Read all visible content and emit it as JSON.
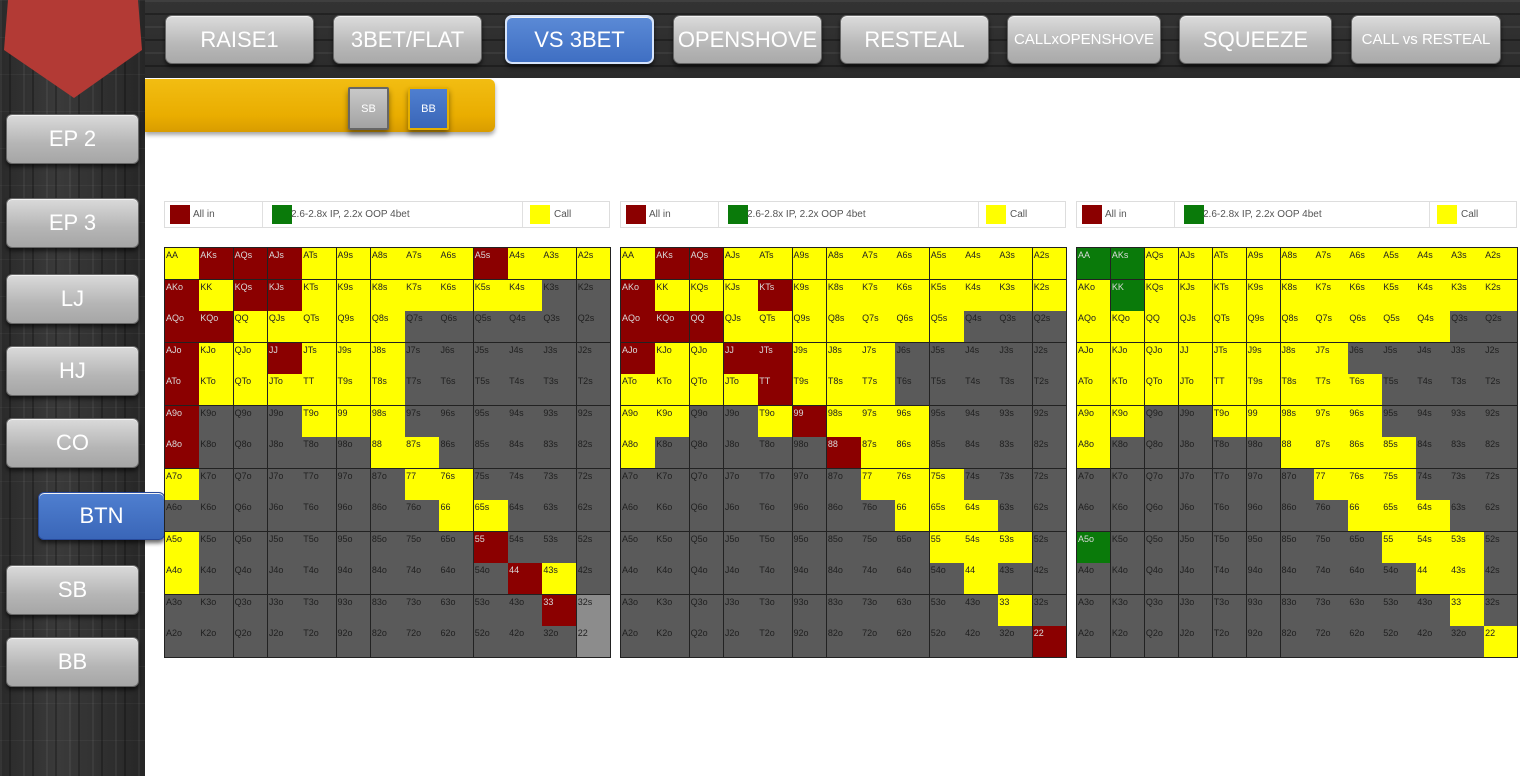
{
  "colors": {
    "allin": "#8b0000",
    "fourbet": "#0a7a0a",
    "call": "#ffff00",
    "fold": "#5a5a5a",
    "lightfold": "#8c8c8c"
  },
  "top_nav": {
    "tabs": [
      {
        "label": "RAISE1",
        "active": false,
        "small": false
      },
      {
        "label": "3BET/FLAT",
        "active": false,
        "small": false
      },
      {
        "label": "VS 3BET",
        "active": true,
        "small": false
      },
      {
        "label": "OPENSHOVE",
        "active": false,
        "small": false
      },
      {
        "label": "RESTEAL",
        "active": false,
        "small": false
      },
      {
        "label": "CALLxOPENSHOVE",
        "active": false,
        "small": true
      },
      {
        "label": "SQUEEZE",
        "active": false,
        "small": false
      },
      {
        "label": "CALL vs RESTEAL",
        "active": false,
        "small": true
      }
    ]
  },
  "side_nav": {
    "items": [
      {
        "label": "EP 2",
        "active": false
      },
      {
        "label": "EP 3",
        "active": false
      },
      {
        "label": "LJ",
        "active": false
      },
      {
        "label": "HJ",
        "active": false
      },
      {
        "label": "CO",
        "active": false
      },
      {
        "label": "BTN",
        "active": true
      },
      {
        "label": "SB",
        "active": false
      },
      {
        "label": "BB",
        "active": false
      }
    ]
  },
  "position_toggle": {
    "sb": "SB",
    "bb": "BB",
    "selected": "BB"
  },
  "legend": {
    "allin": "All in",
    "fourbet": "2.6-2.8x IP, 2.2x OOP 4bet",
    "call": "Call"
  },
  "ranks": [
    "A",
    "K",
    "Q",
    "J",
    "T",
    "9",
    "8",
    "7",
    "6",
    "5",
    "4",
    "3",
    "2"
  ],
  "matrices": [
    {
      "default": "F",
      "overrides": {
        "0,0": "C",
        "0,1": "A",
        "0,2": "A",
        "0,3": "A",
        "0,4": "C",
        "0,5": "C",
        "0,6": "C",
        "0,7": "C",
        "0,8": "C",
        "0,9": "A",
        "0,10": "C",
        "0,11": "C",
        "0,12": "C",
        "1,0": "A",
        "1,1": "C",
        "1,2": "A",
        "1,3": "A",
        "1,4": "C",
        "1,5": "C",
        "1,6": "C",
        "1,7": "C",
        "1,8": "C",
        "1,9": "C",
        "1,10": "C",
        "1,11": "F",
        "1,12": "F",
        "2,0": "A",
        "2,1": "A",
        "2,2": "C",
        "2,3": "C",
        "2,4": "C",
        "2,5": "C",
        "2,6": "C",
        "3,0": "A",
        "3,1": "C",
        "3,2": "C",
        "3,3": "A",
        "3,4": "C",
        "3,5": "C",
        "3,6": "C",
        "4,0": "A",
        "4,1": "C",
        "4,2": "C",
        "4,3": "C",
        "4,4": "C",
        "4,5": "C",
        "4,6": "C",
        "5,0": "A",
        "5,4": "C",
        "5,5": "C",
        "5,6": "C",
        "6,0": "A",
        "6,6": "C",
        "6,7": "C",
        "7,0": "C",
        "7,7": "C",
        "7,8": "C",
        "8,8": "C",
        "8,9": "C",
        "9,0": "C",
        "9,9": "A",
        "10,0": "C",
        "10,10": "A",
        "10,11": "C",
        "11,11": "A",
        "11,12": "L",
        "12,12": "L"
      }
    },
    {
      "default": "F",
      "overrides": {
        "0,0": "C",
        "0,1": "A",
        "0,2": "A",
        "0,3": "C",
        "0,4": "C",
        "0,5": "C",
        "0,6": "C",
        "0,7": "C",
        "0,8": "C",
        "0,9": "C",
        "0,10": "C",
        "0,11": "C",
        "0,12": "C",
        "1,0": "A",
        "1,1": "C",
        "1,2": "C",
        "1,3": "C",
        "1,4": "A",
        "1,5": "C",
        "1,6": "C",
        "1,7": "C",
        "1,8": "C",
        "1,9": "C",
        "1,10": "C",
        "1,11": "C",
        "1,12": "C",
        "2,0": "A",
        "2,1": "A",
        "2,2": "A",
        "2,3": "C",
        "2,4": "C",
        "2,5": "C",
        "2,6": "C",
        "2,7": "C",
        "2,8": "C",
        "2,9": "C",
        "3,0": "A",
        "3,1": "C",
        "3,2": "C",
        "3,3": "A",
        "3,4": "A",
        "3,5": "C",
        "3,6": "C",
        "3,7": "C",
        "4,0": "C",
        "4,1": "C",
        "4,2": "C",
        "4,3": "C",
        "4,4": "A",
        "4,5": "C",
        "4,6": "C",
        "4,7": "C",
        "5,0": "C",
        "5,1": "C",
        "5,4": "C",
        "5,5": "A",
        "5,6": "C",
        "5,7": "C",
        "5,8": "C",
        "6,0": "C",
        "6,6": "A",
        "6,7": "C",
        "6,8": "C",
        "7,7": "C",
        "7,8": "C",
        "7,9": "C",
        "8,8": "C",
        "8,9": "C",
        "8,10": "C",
        "9,9": "C",
        "9,10": "C",
        "9,11": "C",
        "10,10": "C",
        "11,11": "C",
        "12,12": "A"
      }
    },
    {
      "default": "F",
      "overrides": {
        "0,0": "G",
        "0,1": "G",
        "0,2": "C",
        "0,3": "C",
        "0,4": "C",
        "0,5": "C",
        "0,6": "C",
        "0,7": "C",
        "0,8": "C",
        "0,9": "C",
        "0,10": "C",
        "0,11": "C",
        "0,12": "C",
        "1,0": "C",
        "1,1": "G",
        "1,2": "C",
        "1,3": "C",
        "1,4": "C",
        "1,5": "C",
        "1,6": "C",
        "1,7": "C",
        "1,8": "C",
        "1,9": "C",
        "1,10": "C",
        "1,11": "C",
        "1,12": "C",
        "2,0": "C",
        "2,1": "C",
        "2,2": "C",
        "2,3": "C",
        "2,4": "C",
        "2,5": "C",
        "2,6": "C",
        "2,7": "C",
        "2,8": "C",
        "2,9": "C",
        "2,10": "C",
        "3,0": "C",
        "3,1": "C",
        "3,2": "C",
        "3,3": "C",
        "3,4": "C",
        "3,5": "C",
        "3,6": "C",
        "3,7": "C",
        "4,0": "C",
        "4,1": "C",
        "4,2": "C",
        "4,3": "C",
        "4,4": "C",
        "4,5": "C",
        "4,6": "C",
        "4,7": "C",
        "4,8": "C",
        "5,0": "C",
        "5,1": "C",
        "5,4": "C",
        "5,5": "C",
        "5,6": "C",
        "5,7": "C",
        "5,8": "C",
        "6,0": "C",
        "6,6": "C",
        "6,7": "C",
        "6,8": "C",
        "6,9": "C",
        "7,7": "C",
        "7,8": "C",
        "7,9": "C",
        "8,8": "C",
        "8,9": "C",
        "8,10": "C",
        "9,0": "G",
        "9,9": "C",
        "9,10": "C",
        "9,11": "C",
        "10,10": "C",
        "10,11": "C",
        "11,11": "C",
        "12,12": "C"
      }
    }
  ]
}
